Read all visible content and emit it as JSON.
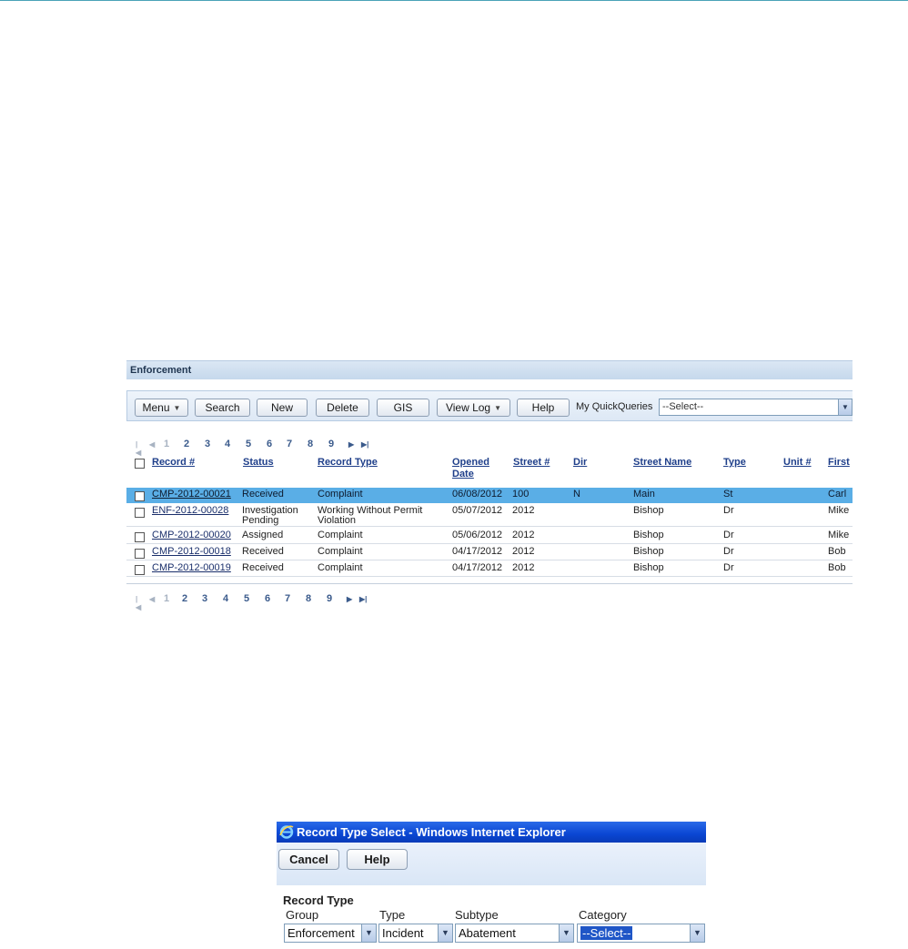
{
  "enforcement": {
    "title": "Enforcement",
    "toolbar": {
      "menu": "Menu",
      "search": "Search",
      "new": "New",
      "delete": "Delete",
      "gis": "GIS",
      "view_log": "View Log",
      "help": "Help",
      "quickqueries_label": "My QuickQueries",
      "quickqueries_value": "--Select--"
    },
    "pager": {
      "current": "1",
      "pages": [
        "2",
        "3",
        "4",
        "5",
        "6",
        "7",
        "8",
        "9"
      ]
    },
    "columns": [
      "Record #",
      "Status",
      "Record Type",
      "Opened",
      "Date",
      "Street #",
      "Dir",
      "Street Name",
      "Type",
      "Unit #",
      "First"
    ],
    "rows": [
      {
        "record": "CMP-2012-00021",
        "status": "Received",
        "status2": "",
        "record_type": "Complaint",
        "record_type2": "",
        "opened": "06/08/2012",
        "street_no": "100",
        "dir": "N",
        "street_name": "Main",
        "type": "St",
        "unit": "",
        "first": "Carl",
        "selected": true
      },
      {
        "record": "ENF-2012-00028",
        "status": "Investigation",
        "status2": "Pending",
        "record_type": "Working Without Permit",
        "record_type2": "Violation",
        "opened": "05/07/2012",
        "street_no": "2012",
        "dir": "",
        "street_name": "Bishop",
        "type": "Dr",
        "unit": "",
        "first": "Mike",
        "selected": false
      },
      {
        "record": "CMP-2012-00020",
        "status": "Assigned",
        "status2": "",
        "record_type": "Complaint",
        "record_type2": "",
        "opened": "05/06/2012",
        "street_no": "2012",
        "dir": "",
        "street_name": "Bishop",
        "type": "Dr",
        "unit": "",
        "first": "Mike",
        "selected": false
      },
      {
        "record": "CMP-2012-00018",
        "status": "Received",
        "status2": "",
        "record_type": "Complaint",
        "record_type2": "",
        "opened": "04/17/2012",
        "street_no": "2012",
        "dir": "",
        "street_name": "Bishop",
        "type": "Dr",
        "unit": "",
        "first": "Bob",
        "selected": false
      },
      {
        "record": "CMP-2012-00019",
        "status": "Received",
        "status2": "",
        "record_type": "Complaint",
        "record_type2": "",
        "opened": "04/17/2012",
        "street_no": "2012",
        "dir": "",
        "street_name": "Bishop",
        "type": "Dr",
        "unit": "",
        "first": "Bob",
        "selected": false
      }
    ],
    "selected_row_color": "#5aaee6"
  },
  "dialog": {
    "window_title": "Record Type Select - Windows Internet Explorer",
    "title_bar_color": "#0a46d3",
    "cancel": "Cancel",
    "help": "Help",
    "section_title": "Record Type",
    "labels": {
      "group": "Group",
      "type": "Type",
      "subtype": "Subtype",
      "category": "Category"
    },
    "values": {
      "group": "Enforcement",
      "type": "Incident",
      "subtype": "Abatement",
      "category": "--Select--"
    }
  }
}
